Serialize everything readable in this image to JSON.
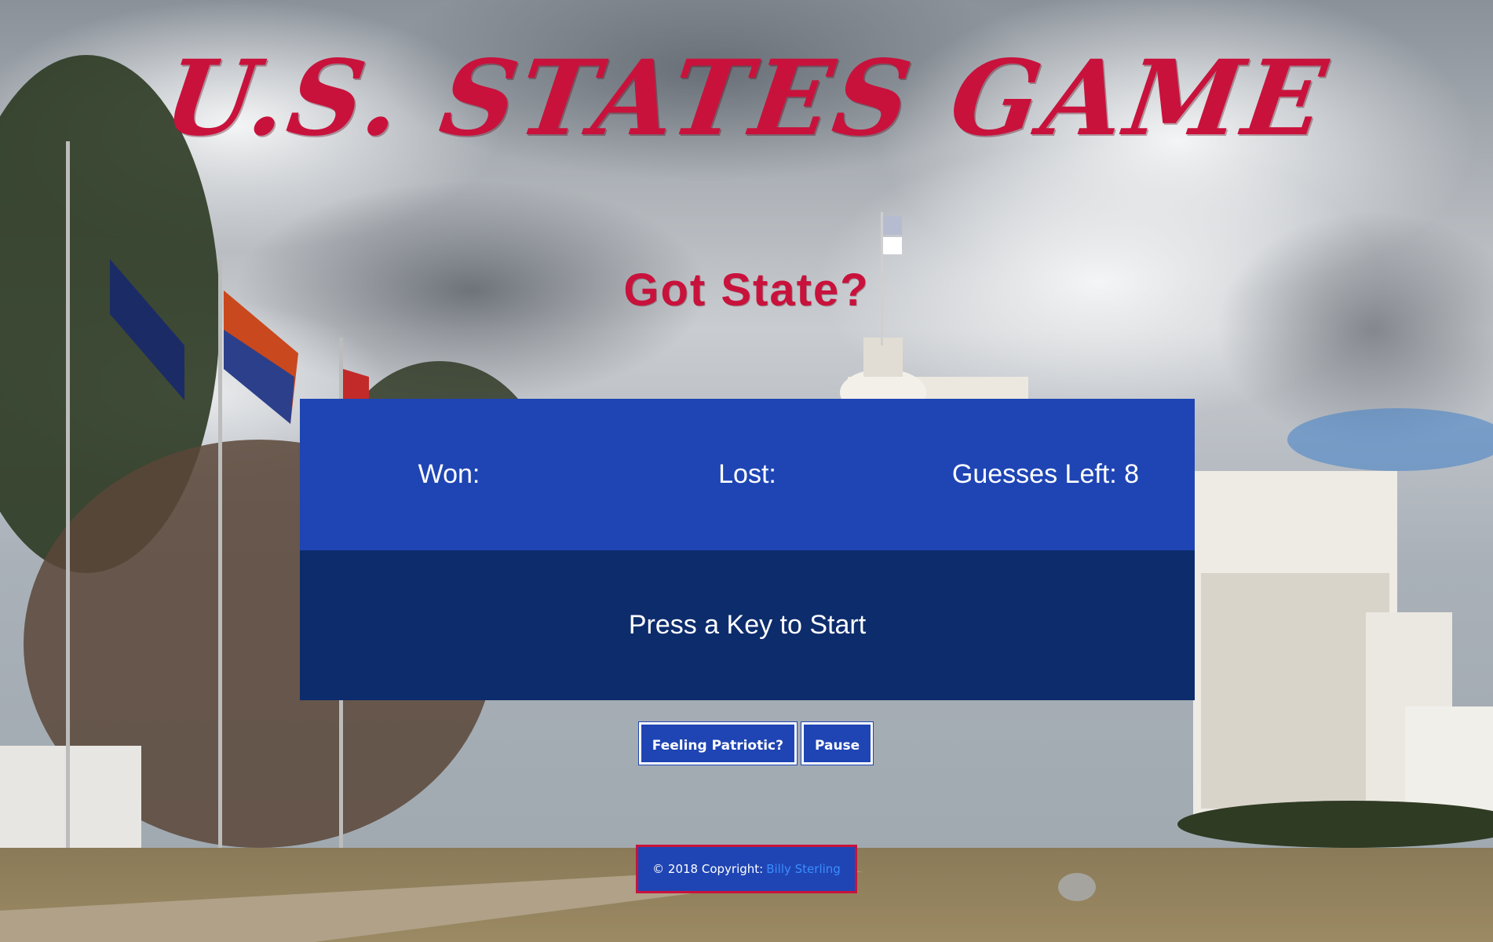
{
  "page": {
    "title": "U.S. STATES GAME",
    "subtitle": "Got State?"
  },
  "scoreboard": {
    "won_label": "Won:",
    "lost_label": "Lost:",
    "guesses_label": "Guesses Left: 8"
  },
  "message": {
    "text": "Press a Key to Start"
  },
  "buttons": {
    "patriotic_label": "Feeling Patriotic?",
    "pause_label": "Pause"
  },
  "footer": {
    "copyright_text": "© 2018 Copyright:",
    "author_link": "Billy Sterling"
  },
  "colors": {
    "title_red": "#c8123c",
    "panel_blue": "#1f45b4",
    "panel_navy": "#0d2c6c",
    "link_blue": "#3b8cff"
  }
}
